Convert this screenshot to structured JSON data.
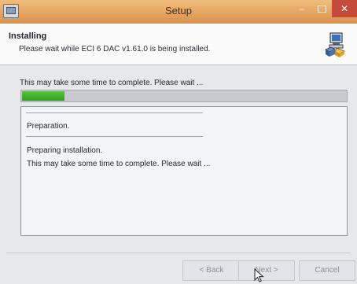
{
  "window": {
    "title": "Setup",
    "minimize_glyph": "‒",
    "close_glyph": "✕"
  },
  "header": {
    "title": "Installing",
    "subtitle": "Please wait while ECI 6 DAC v1.61.0 is being installed.",
    "icon": "installer-computer-icon"
  },
  "status": {
    "text": "This may take some time to complete. Please wait ...",
    "progress_fraction": 0.13,
    "progress_color": "#3aad2a"
  },
  "log": {
    "lines": [
      "Preparation.",
      "Preparing installation.",
      "This may take some time to complete. Please wait ..."
    ]
  },
  "buttons": {
    "back": "< Back",
    "next": "Next >",
    "cancel": "Cancel"
  },
  "colors": {
    "titlebar": "#e6a461",
    "close_button": "#c44b3c"
  }
}
